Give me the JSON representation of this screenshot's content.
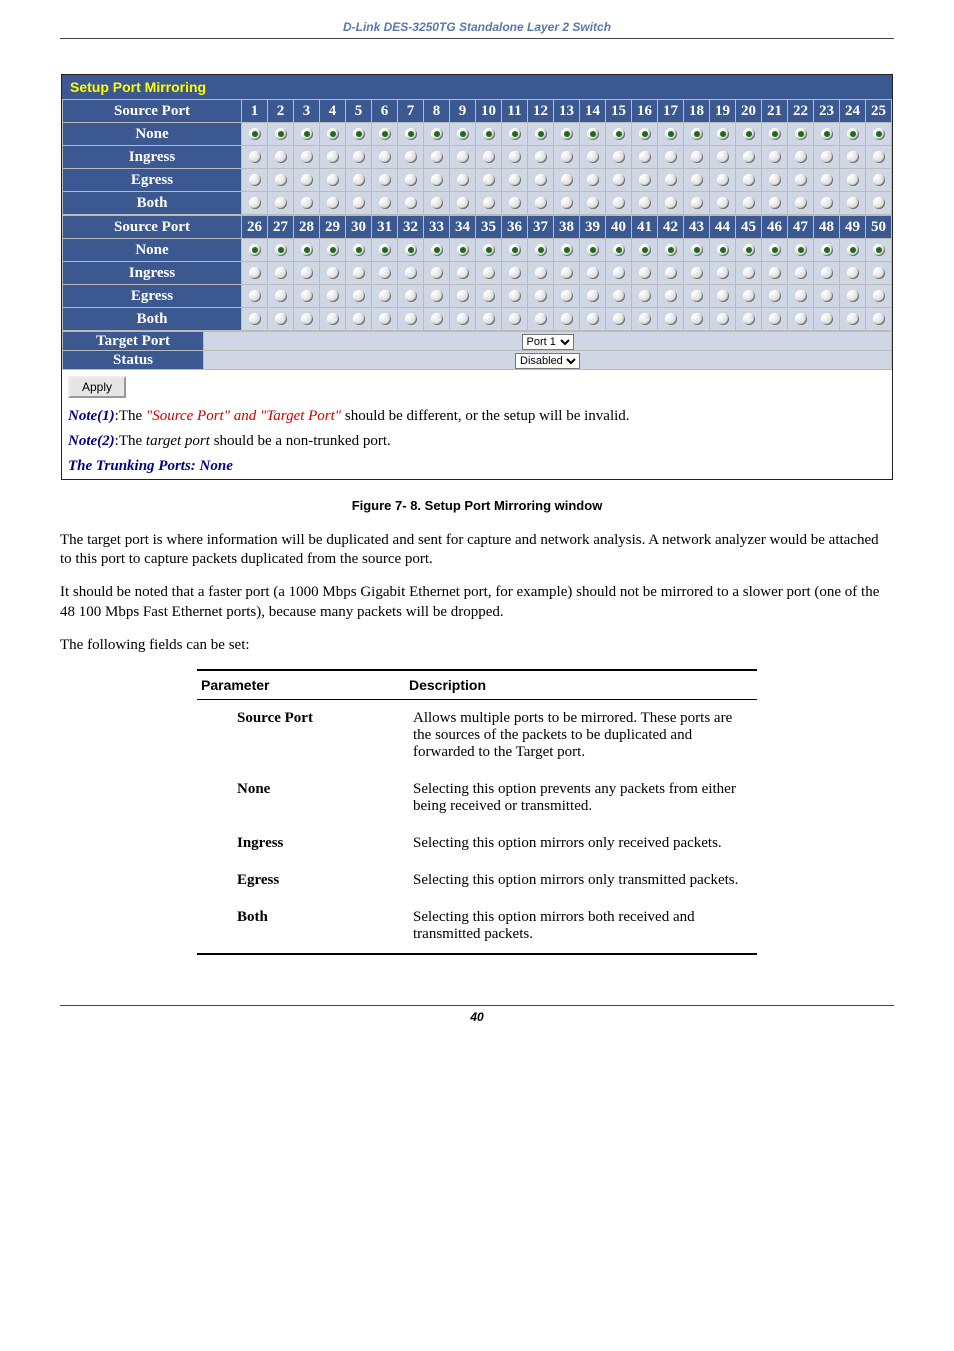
{
  "doc_header": "D-Link DES-3250TG Standalone Layer 2 Switch",
  "mirror_title": "Setup Port Mirroring",
  "header_source_port": "Source Port",
  "row1": {
    "columns": [
      "1",
      "2",
      "3",
      "4",
      "5",
      "6",
      "7",
      "8",
      "9",
      "10",
      "11",
      "12",
      "13",
      "14",
      "15",
      "16",
      "17",
      "18",
      "19",
      "20",
      "21",
      "22",
      "23",
      "24",
      "25"
    ],
    "rows": [
      "None",
      "Ingress",
      "Egress",
      "Both"
    ],
    "selected_row": "None"
  },
  "row2": {
    "columns": [
      "26",
      "27",
      "28",
      "29",
      "30",
      "31",
      "32",
      "33",
      "34",
      "35",
      "36",
      "37",
      "38",
      "39",
      "40",
      "41",
      "42",
      "43",
      "44",
      "45",
      "46",
      "47",
      "48",
      "49",
      "50"
    ],
    "rows": [
      "None",
      "Ingress",
      "Egress",
      "Both"
    ],
    "selected_row": "None"
  },
  "target_port_label": "Target Port",
  "target_port_value": "Port 1",
  "status_label": "Status",
  "status_value": "Disabled",
  "apply_label": "Apply",
  "note1_prefix": "Note(1)",
  "note1_text": ":The ",
  "note1_quoted": "\"Source Port\" and \"Target Port\"",
  "note1_rest": " should be different, or the setup will be invalid.",
  "note2_prefix": "Note(2)",
  "note2_text": ":The ",
  "note2_ital": "target port",
  "note2_rest": " should be a non-trunked port.",
  "trunking": "The Trunking Ports: None",
  "caption": "Figure 7- 8.  Setup Port Mirroring window",
  "para1": "The target port is where information will be duplicated and sent for capture and network analysis. A network analyzer would be attached to this port to capture packets duplicated from the source port.",
  "para2": "It should be noted that a faster port (a 1000 Mbps Gigabit Ethernet port, for example) should not be mirrored to a slower port (one of the 48 100 Mbps Fast Ethernet ports), because many packets will be dropped.",
  "para3": "The following fields can be set:",
  "table_header_param": "Parameter",
  "table_header_desc": "Description",
  "params": [
    {
      "name": "Source Port",
      "desc": "Allows multiple ports to be mirrored. These ports are the sources of the packets to be duplicated and forwarded to the Target port."
    },
    {
      "name": "None",
      "desc": "Selecting this option prevents any packets from either being received or transmitted."
    },
    {
      "name": "Ingress",
      "desc": "Selecting this option mirrors only received packets."
    },
    {
      "name": "Egress",
      "desc": "Selecting this option mirrors only transmitted packets."
    },
    {
      "name": "Both",
      "desc": "Selecting this option mirrors both received and transmitted packets."
    }
  ],
  "page_number": "40"
}
